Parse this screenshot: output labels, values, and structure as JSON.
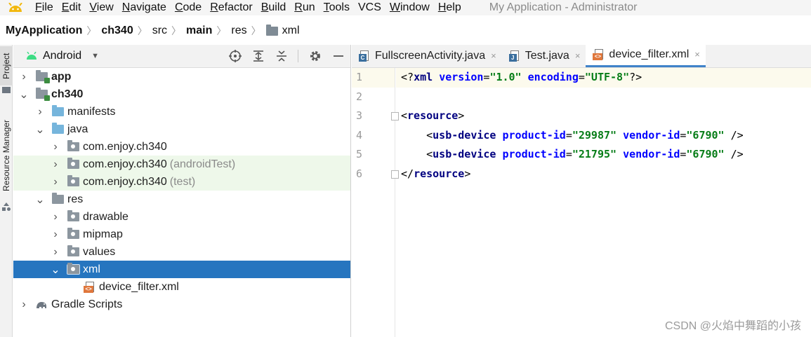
{
  "menubar": {
    "items": [
      {
        "label": "File",
        "mnemonic": "F",
        "rest": "ile"
      },
      {
        "label": "Edit",
        "mnemonic": "E",
        "rest": "dit"
      },
      {
        "label": "View",
        "mnemonic": "V",
        "rest": "iew"
      },
      {
        "label": "Navigate",
        "mnemonic": "N",
        "rest": "avigate"
      },
      {
        "label": "Code",
        "mnemonic": "C",
        "rest": "ode"
      },
      {
        "label": "Refactor",
        "mnemonic": "R",
        "rest": "efactor"
      },
      {
        "label": "Build",
        "mnemonic": "B",
        "rest": "uild"
      },
      {
        "label": "Run",
        "mnemonic": "R",
        "rest": "un"
      },
      {
        "label": "Tools",
        "mnemonic": "T",
        "rest": "ools"
      },
      {
        "label": "VCS",
        "mnemonic": "",
        "rest": "VCS"
      },
      {
        "label": "Window",
        "mnemonic": "W",
        "rest": "indow"
      },
      {
        "label": "Help",
        "mnemonic": "H",
        "rest": "elp"
      }
    ],
    "title": "My Application - Administrator"
  },
  "breadcrumb": {
    "items": [
      "MyApplication",
      "ch340",
      "src",
      "main",
      "res",
      "xml"
    ]
  },
  "leftstrip": {
    "project_tab": "Project",
    "resource_tab": "Resource Manager"
  },
  "project_panel": {
    "view": "Android",
    "tree": [
      {
        "label": "app",
        "bold": true,
        "suffix": ""
      },
      {
        "label": "ch340",
        "bold": true,
        "suffix": ""
      },
      {
        "label": "manifests",
        "bold": false,
        "suffix": ""
      },
      {
        "label": "java",
        "bold": false,
        "suffix": ""
      },
      {
        "label": "com.enjoy.ch340",
        "bold": false,
        "suffix": ""
      },
      {
        "label": "com.enjoy.ch340",
        "bold": false,
        "suffix": "(androidTest)"
      },
      {
        "label": "com.enjoy.ch340",
        "bold": false,
        "suffix": "(test)"
      },
      {
        "label": "res",
        "bold": false,
        "suffix": ""
      },
      {
        "label": "drawable",
        "bold": false,
        "suffix": ""
      },
      {
        "label": "mipmap",
        "bold": false,
        "suffix": ""
      },
      {
        "label": "values",
        "bold": false,
        "suffix": ""
      },
      {
        "label": "xml",
        "bold": false,
        "suffix": ""
      },
      {
        "label": "device_filter.xml",
        "bold": false,
        "suffix": ""
      },
      {
        "label": "Gradle Scripts",
        "bold": false,
        "suffix": ""
      }
    ]
  },
  "editor": {
    "tabs": [
      {
        "label": "FullscreenActivity.java",
        "close": "×"
      },
      {
        "label": "Test.java",
        "close": "×"
      },
      {
        "label": "device_filter.xml",
        "close": "×"
      }
    ],
    "line_numbers": [
      "1",
      "2",
      "3",
      "4",
      "5",
      "6"
    ],
    "lines": [
      [
        [
          "punc",
          "<?"
        ],
        [
          "tag",
          "xml "
        ],
        [
          "attr",
          "version"
        ],
        [
          "punc",
          "="
        ],
        [
          "val",
          "\"1.0\""
        ],
        [
          "punc",
          " "
        ],
        [
          "attr",
          "encoding"
        ],
        [
          "punc",
          "="
        ],
        [
          "val",
          "\"UTF-8\""
        ],
        [
          "punc",
          "?>"
        ]
      ],
      [],
      [
        [
          "punc",
          "<"
        ],
        [
          "tag",
          "resource"
        ],
        [
          "punc",
          ">"
        ]
      ],
      [
        [
          "punc",
          "    <"
        ],
        [
          "tag",
          "usb-device "
        ],
        [
          "attr",
          "product-id"
        ],
        [
          "punc",
          "="
        ],
        [
          "val",
          "\"29987\""
        ],
        [
          "punc",
          " "
        ],
        [
          "attr",
          "vendor-id"
        ],
        [
          "punc",
          "="
        ],
        [
          "val",
          "\"6790\""
        ],
        [
          "punc",
          " />"
        ]
      ],
      [
        [
          "punc",
          "    <"
        ],
        [
          "tag",
          "usb-device "
        ],
        [
          "attr",
          "product-id"
        ],
        [
          "punc",
          "="
        ],
        [
          "val",
          "\"21795\""
        ],
        [
          "punc",
          " "
        ],
        [
          "attr",
          "vendor-id"
        ],
        [
          "punc",
          "="
        ],
        [
          "val",
          "\"6790\""
        ],
        [
          "punc",
          " />"
        ]
      ],
      [
        [
          "punc",
          "</"
        ],
        [
          "tag",
          "resource"
        ],
        [
          "punc",
          ">"
        ]
      ]
    ]
  },
  "watermark": "CSDN @火焰中舞蹈的小孩"
}
